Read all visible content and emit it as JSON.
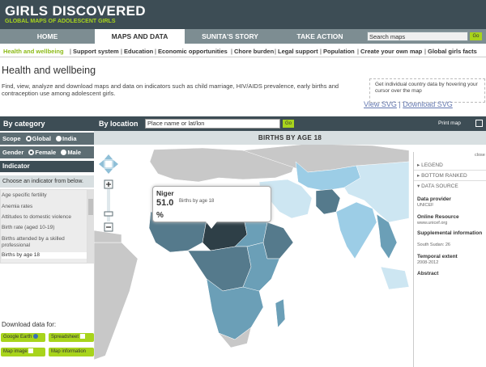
{
  "header": {
    "site_title": "GIRLS DISCOVERED",
    "tagline": "GLOBAL MAPS OF ADOLESCENT GIRLS"
  },
  "nav": {
    "items": [
      "HOME",
      "MAPS AND DATA",
      "SUNITA'S STORY",
      "TAKE ACTION"
    ],
    "active": "MAPS AND DATA",
    "search_placeholder": "Search maps",
    "go": "Go"
  },
  "subnav": {
    "items": [
      "Health and wellbeing",
      "Support system",
      "Education",
      "Economic opportunities",
      "Chore burden",
      "Legal support",
      "Population",
      "Create your own map",
      "Global girls facts"
    ],
    "separator": "|"
  },
  "page": {
    "title": "Health and wellbeing",
    "intro": "Find, view, analyze and download maps and data on indicators such as child marriage, HIV/AIDS prevalence, early births and contraception use among adolescent girls.",
    "tip": "Get individual country data by hovering your cursor over the map",
    "view_svg": "View SVG",
    "download_svg": "Download SVG",
    "svg_sep": "|"
  },
  "sidebar": {
    "by_category": "By category",
    "scope_label": "Scope",
    "scope_options": [
      "Global",
      "India"
    ],
    "gender_label": "Gender",
    "gender_options": [
      "Female",
      "Male"
    ],
    "indicator": "Indicator",
    "choose": "Choose an indicator from below.",
    "indicators": [
      "Age specific fertility",
      "Anemia rates",
      "Attitudes to domestic violence",
      "Birth rate (aged 10-19)",
      "Births attended by a skilled professional",
      "Births by age 18"
    ],
    "selected_indicator": "Births by age 18",
    "download_label": "Download data for:",
    "download_buttons": [
      "Google Earth",
      "Spreadsheet",
      "Map image",
      "Map information"
    ]
  },
  "toolbar": {
    "by_location": "By location",
    "place_placeholder": "Place name or lat/lon",
    "go": "Go",
    "print": "Print map"
  },
  "map": {
    "title": "BIRTHS BY AGE 18",
    "colors": {
      "ocean": "#ffffff",
      "nodata": "#c8c8c8",
      "c1": "#cde6f2",
      "c2": "#9ccde6",
      "c3": "#6b9fb7",
      "c4": "#557a8c",
      "c5": "#2e3f47"
    }
  },
  "popup": {
    "country": "Niger",
    "value": "51.0",
    "unit": "%",
    "label": "Births by age 18"
  },
  "panel": {
    "close": "close",
    "legend": "LEGEND",
    "bottom_ranked": "BOTTOM RANKED",
    "data_source": "DATA SOURCE",
    "provider_label": "Data provider",
    "provider_value": "UNICEF",
    "online_label": "Online Resource",
    "online_value": "www.unicef.org",
    "supp_label": "Supplemental information",
    "supp_value": "South Sudan: 26",
    "temporal_label": "Temporal extent",
    "temporal_value": "2008-2012",
    "abstract_label": "Abstract"
  }
}
